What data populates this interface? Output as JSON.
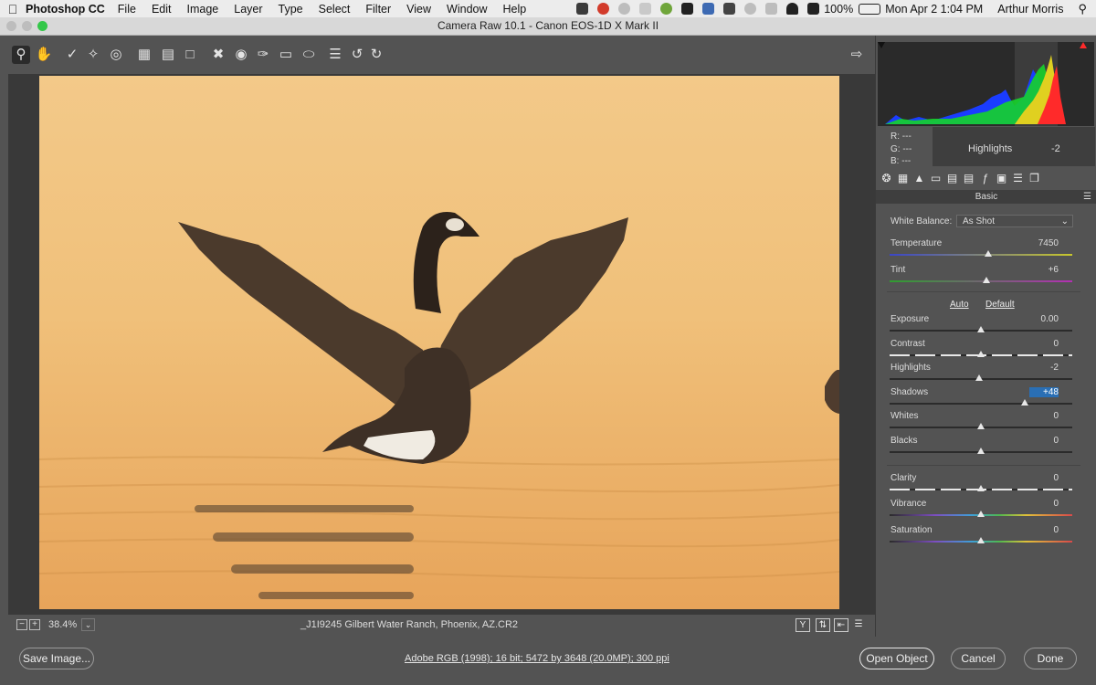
{
  "menubar": {
    "app_name": "Photoshop CC",
    "menus": [
      "File",
      "Edit",
      "Image",
      "Layer",
      "Type",
      "Select",
      "Filter",
      "View",
      "Window",
      "Help"
    ],
    "battery": "100%",
    "clock": "Mon Apr 2  1:04 PM",
    "user": "Arthur Morris"
  },
  "window": {
    "title": "Camera Raw 10.1  -  Canon EOS-1D X Mark II"
  },
  "toolbar": {
    "tools": [
      "zoom-tool",
      "hand-tool",
      "white-balance-tool",
      "color-sampler-tool",
      "targeted-adjustment-tool",
      "crop-tool",
      "straighten-tool",
      "transform-tool",
      "spot-removal-tool",
      "red-eye-tool",
      "adjustment-brush-tool",
      "graduated-filter-tool",
      "radial-filter-tool",
      "preferences",
      "rotate-ccw",
      "rotate-cw"
    ],
    "active_tool": "zoom-tool"
  },
  "status": {
    "zoom": "38.4%",
    "filename": "_J1I9245  Gilbert Water Ranch, Phoenix, AZ.CR2",
    "view_buttons": [
      "Y"
    ]
  },
  "bottom": {
    "save_label": "Save Image...",
    "workflow": "Adobe RGB (1998); 16 bit; 5472 by 3648 (20.0MP); 300 ppi",
    "open_label": "Open Object",
    "cancel_label": "Cancel",
    "done_label": "Done"
  },
  "readout": {
    "r_label": "R:",
    "r_value": "---",
    "g_label": "G:",
    "g_value": "---",
    "b_label": "B:",
    "b_value": "---",
    "hint_label": "Highlights",
    "hint_value": "-2"
  },
  "panel": {
    "section": "Basic",
    "white_balance_label": "White Balance:",
    "white_balance_value": "As Shot",
    "auto_label": "Auto",
    "default_label": "Default",
    "sliders": [
      {
        "label": "Temperature",
        "value": "7450",
        "pos": 0.54
      },
      {
        "label": "Tint",
        "value": "+6",
        "pos": 0.53
      },
      {
        "label": "Exposure",
        "value": "0.00",
        "pos": 0.5
      },
      {
        "label": "Contrast",
        "value": "0",
        "pos": 0.5
      },
      {
        "label": "Highlights",
        "value": "-2",
        "pos": 0.49
      },
      {
        "label": "Shadows",
        "value": "+48",
        "pos": 0.74,
        "selected": true
      },
      {
        "label": "Whites",
        "value": "0",
        "pos": 0.5
      },
      {
        "label": "Blacks",
        "value": "0",
        "pos": 0.5
      },
      {
        "label": "Clarity",
        "value": "0",
        "pos": 0.5
      },
      {
        "label": "Vibrance",
        "value": "0",
        "pos": 0.5
      },
      {
        "label": "Saturation",
        "value": "0",
        "pos": 0.5
      }
    ]
  },
  "colors": {
    "accent": "#2a6fb5",
    "panel_bg": "#535353",
    "stage_bg": "#393939"
  }
}
